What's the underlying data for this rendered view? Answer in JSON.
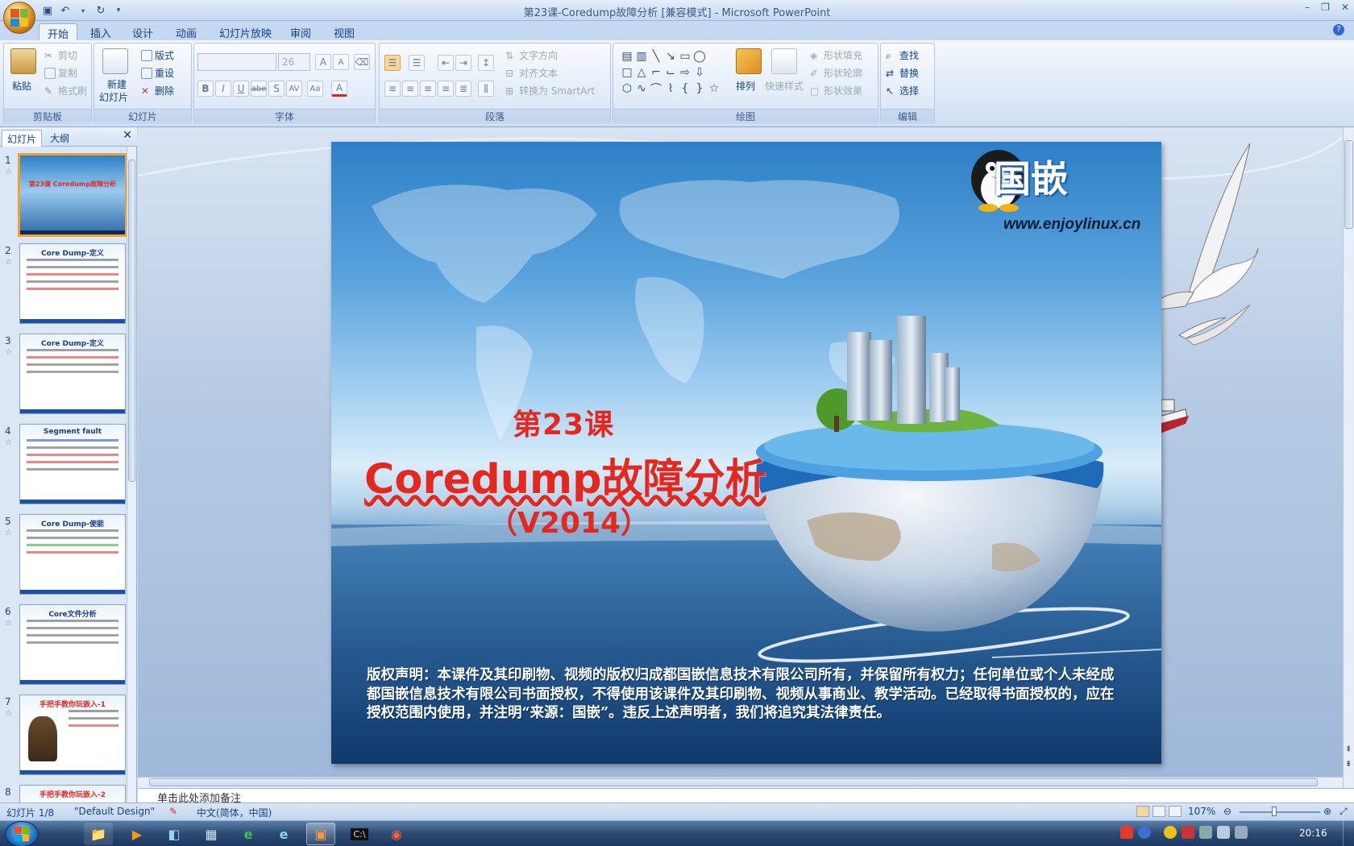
{
  "window": {
    "title": "第23课-Coredump故障分析 [兼容模式] - Microsoft PowerPoint",
    "controls": [
      "–",
      "❐",
      "✕"
    ]
  },
  "ribbon_tabs": [
    "开始",
    "插入",
    "设计",
    "动画",
    "幻灯片放映",
    "审阅",
    "视图"
  ],
  "ribbon": {
    "clipboard": {
      "label": "剪贴板",
      "paste": "粘贴",
      "cut": "剪切",
      "copy": "复制",
      "format_painter": "格式刷"
    },
    "slides": {
      "label": "幻灯片",
      "new_slide_line1": "新建",
      "new_slide_line2": "幻灯片",
      "layout": "版式",
      "reset": "重设",
      "delete": "删除"
    },
    "font": {
      "label": "字体",
      "size": "26",
      "bold": "B",
      "italic": "I",
      "underline": "U",
      "strike": "abe",
      "shadow": "S",
      "spacing": "AV",
      "case": "Aa",
      "color": "A",
      "grow": "A",
      "shrink": "A"
    },
    "paragraph": {
      "label": "段落",
      "text_direction": "文字方向",
      "align_text": "对齐文本",
      "smartart": "转换为 SmartArt"
    },
    "drawing": {
      "label": "绘图",
      "arrange": "排列",
      "quick_styles": "快速样式",
      "shape_fill": "形状填充",
      "shape_outline": "形状轮廓",
      "shape_effects": "形状效果"
    },
    "editing": {
      "label": "编辑",
      "find": "查找",
      "replace": "替换",
      "select": "选择"
    }
  },
  "pane": {
    "tab_slides": "幻灯片",
    "tab_outline": "大纲",
    "thumbnails": [
      {
        "num": "1",
        "title": "第23课 Coredump故障分析",
        "style": "title"
      },
      {
        "num": "2",
        "title": "Core Dump-定义"
      },
      {
        "num": "3",
        "title": "Core Dump-定义"
      },
      {
        "num": "4",
        "title": "Segment fault"
      },
      {
        "num": "5",
        "title": "Core Dump-使能"
      },
      {
        "num": "6",
        "title": "Core文件分析"
      },
      {
        "num": "7",
        "title": "手把手教你玩嵌入-1"
      },
      {
        "num": "8",
        "title": "手把手教你玩嵌入-2"
      }
    ]
  },
  "slide": {
    "brand": "国嵌",
    "url": "www.enjoylinux.cn",
    "lesson": "第23课",
    "title": "Coredump故障分析",
    "version": "（V2014）",
    "copyright": "版权声明：本课件及其印刷物、视频的版权归成都国嵌信息技术有限公司所有，并保留所有权力；任何单位或个人未经成都国嵌信息技术有限公司书面授权，不得使用该课件及其印刷物、视频从事商业、教学活动。已经取得书面授权的，应在授权范围内使用，并注明“来源：国嵌”。违反上述声明者，我们将追究其法律责任。"
  },
  "notes": {
    "placeholder": "单击此处添加备注"
  },
  "status": {
    "slide_counter": "幻灯片 1/8",
    "theme": "\"Default Design\"",
    "language": "中文(简体，中国)",
    "zoom": "107%"
  },
  "taskbar": {
    "clock": "20:16"
  },
  "colors": {
    "title_red": "#e5281f",
    "ribbon_blue": "#15428b",
    "selection_orange": "#f0a030"
  }
}
